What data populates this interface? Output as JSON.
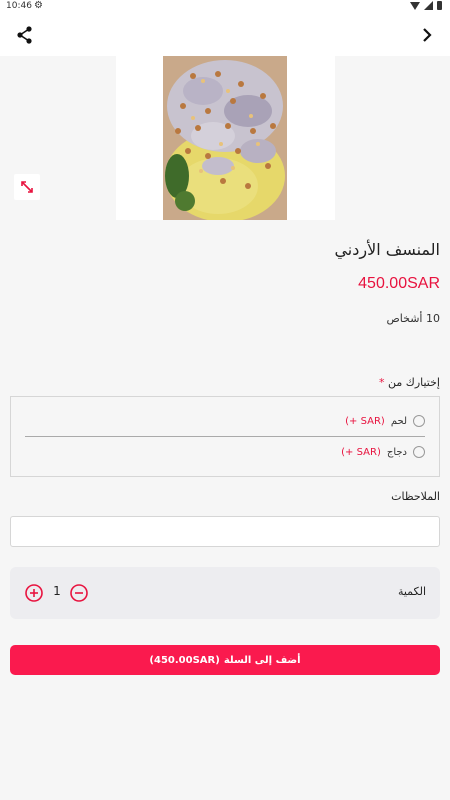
{
  "status_bar": {
    "time": "10:46"
  },
  "product": {
    "title": "المنسف الأردني",
    "price": "450.00SAR",
    "serves": "10 أشخاص"
  },
  "choice": {
    "label": "إختيارك من",
    "required_mark": "*",
    "options": [
      {
        "name": "لحم",
        "delta": "(SAR +)"
      },
      {
        "name": "دجاج",
        "delta": "(SAR +)"
      }
    ]
  },
  "notes": {
    "label": "الملاحظات",
    "value": ""
  },
  "quantity": {
    "label": "الكمية",
    "value": "1"
  },
  "cart_button": {
    "label": "أضف إلى السلة",
    "price": "(450.00SAR)"
  },
  "colors": {
    "accent": "#fa1a4e",
    "price": "#e8133f"
  },
  "icons": [
    "share-icon",
    "chevron-right-icon",
    "expand-icon",
    "plus-circle-icon",
    "minus-circle-icon"
  ]
}
